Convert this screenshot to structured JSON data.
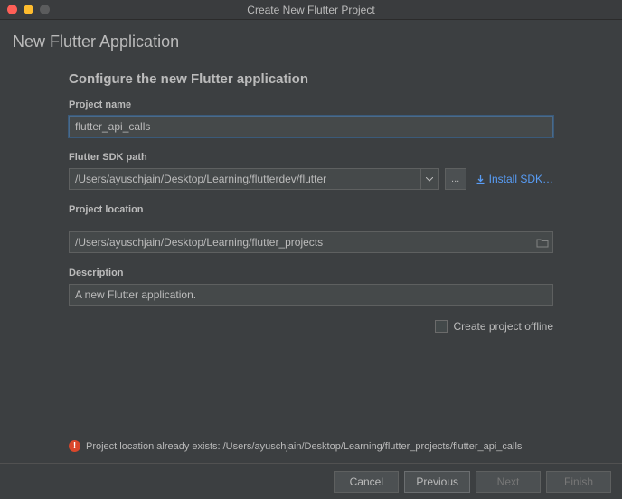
{
  "window": {
    "title": "Create New Flutter Project"
  },
  "header": {
    "title": "New Flutter Application"
  },
  "section": {
    "title": "Configure the new Flutter application"
  },
  "fields": {
    "projectName": {
      "label": "Project name",
      "value": "flutter_api_calls"
    },
    "sdkPath": {
      "label": "Flutter SDK path",
      "value": "/Users/ayuschjain/Desktop/Learning/flutterdev/flutter",
      "browse": "...",
      "installLink": "Install SDK…"
    },
    "projectLocation": {
      "label": "Project location",
      "value": "/Users/ayuschjain/Desktop/Learning/flutter_projects"
    },
    "description": {
      "label": "Description",
      "value": "A new Flutter application."
    },
    "offline": {
      "label": "Create project offline",
      "checked": false
    }
  },
  "error": {
    "message": "Project location already exists: /Users/ayuschjain/Desktop/Learning/flutter_projects/flutter_api_calls"
  },
  "buttons": {
    "cancel": "Cancel",
    "previous": "Previous",
    "next": "Next",
    "finish": "Finish"
  }
}
